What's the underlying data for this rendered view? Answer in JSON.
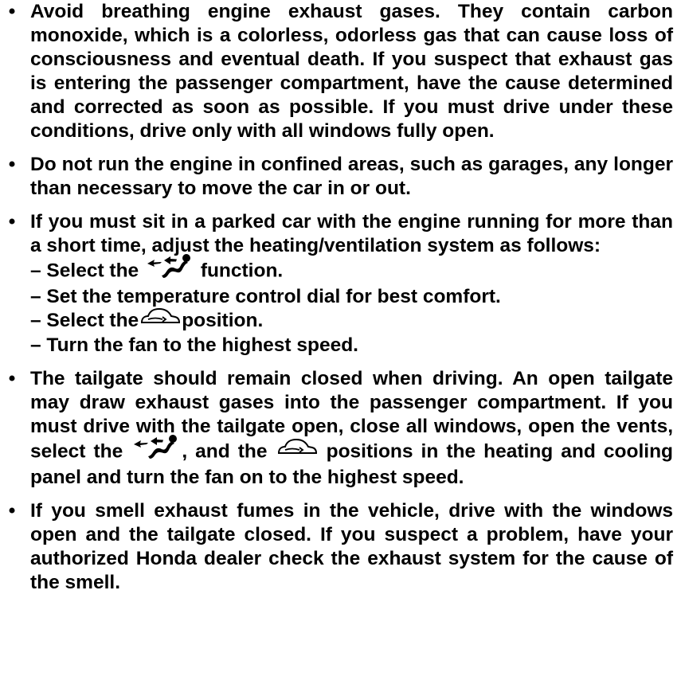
{
  "bullets": [
    {
      "text": "Avoid breathing engine exhaust gases. They contain carbon monoxide, which is a colorless, odorless gas that can cause loss of consciousness and eventual death. If you suspect that exhaust gas is entering the passenger compartment, have the cause determined and corrected as soon as possible. If you must drive under these conditions, drive only with all windows fully open."
    },
    {
      "text": "Do not run the engine in confined areas, such as garages, any longer than necessary to move the car in or out."
    },
    {
      "intro": "If you must sit in a parked car with the engine running for more than a short time, adjust the heating/ventilation system as follows:",
      "steps": {
        "s1_before": "– Select the",
        "s1_after": "function.",
        "s2": "– Set the temperature control dial for best comfort.",
        "s3_before": "– Select the",
        "s3_after": "position.",
        "s4": "– Turn the fan to the highest speed."
      }
    },
    {
      "part1": "The tailgate should remain closed when driving. An open tailgate may draw exhaust gases into the passenger compartment. If you must drive with the tailgate open, close all windows, open the vents, select the",
      "part2": ", and the",
      "part3": "positions in the heating and cooling panel and turn the fan on to the highest speed."
    },
    {
      "text": "If you smell exhaust fumes in the vehicle, drive with the windows open and the tailgate closed. If you suspect a problem, have your authorized Honda dealer check the exhaust system for the cause of the smell."
    }
  ],
  "bullet_symbol": "•",
  "icons": {
    "vent": "vent-mode-icon",
    "recirc": "fresh-air-icon"
  },
  "colors": {
    "text": "#000000",
    "background": "#ffffff"
  }
}
